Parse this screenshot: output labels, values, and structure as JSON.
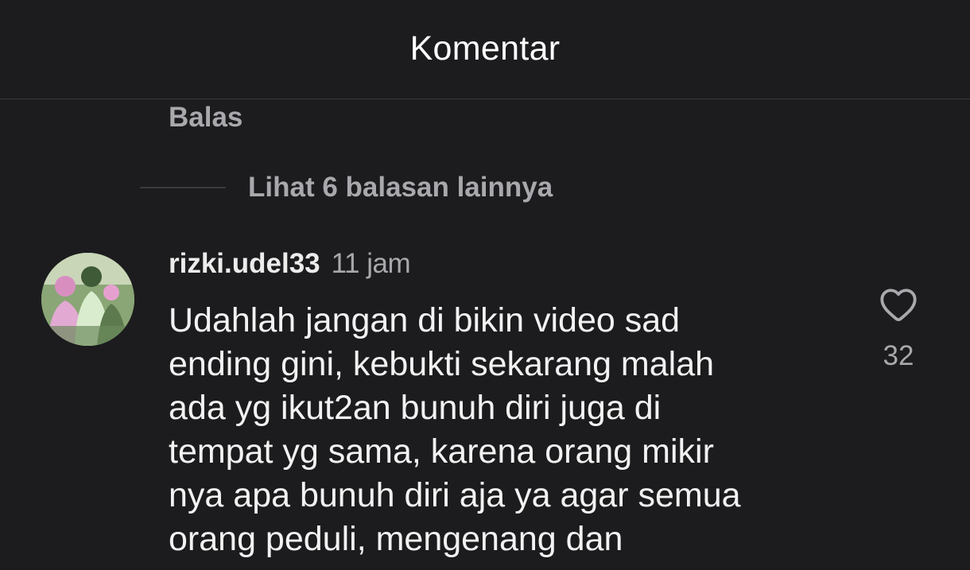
{
  "header": {
    "title": "Komentar"
  },
  "thread": {
    "reply_label": "Balas",
    "more_replies_label": "Lihat 6 balasan lainnya"
  },
  "comment": {
    "username": "rizki.udel33",
    "time": "11 jam",
    "text": "Udahlah jangan di bikin video sad\nending gini, kebukti sekarang malah\nada yg ikut2an bunuh diri juga di\ntempat yg sama, karena orang mikir\nnya apa bunuh diri aja ya agar semua\norang peduli,  mengenang dan",
    "like_count": "32",
    "like_icon": "heart-outline-icon"
  },
  "colors": {
    "background": "#1c1c1e",
    "primary_text": "#f2f2f2",
    "secondary_text": "#a8a8ad",
    "divider": "#3a3a3c"
  }
}
